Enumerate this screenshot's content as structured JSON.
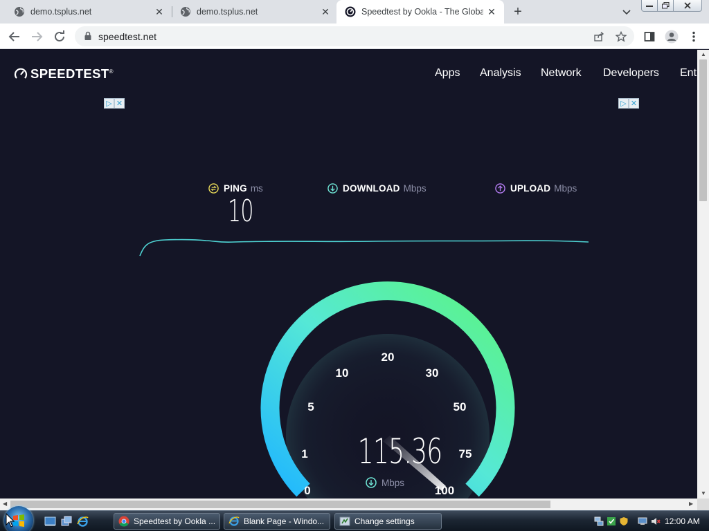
{
  "browser": {
    "tabs": [
      {
        "title": "demo.tsplus.net",
        "active": false
      },
      {
        "title": "demo.tsplus.net",
        "active": false
      },
      {
        "title": "Speedtest by Ookla - The Global",
        "active": true
      }
    ],
    "url": "speedtest.net"
  },
  "site": {
    "logo_text": "SPEEDTEST",
    "nav": [
      "Apps",
      "Analysis",
      "Network",
      "Developers",
      "Ent"
    ]
  },
  "metrics": {
    "ping": {
      "label": "PING",
      "unit": "ms",
      "value": "10"
    },
    "download": {
      "label": "DOWNLOAD",
      "unit": "Mbps"
    },
    "upload": {
      "label": "UPLOAD",
      "unit": "Mbps"
    }
  },
  "gauge": {
    "ticks": [
      "0",
      "1",
      "5",
      "10",
      "20",
      "30",
      "50",
      "75",
      "100"
    ],
    "value": "115.36",
    "unit": "Mbps"
  },
  "colors": {
    "background": "#141526",
    "gauge_start": "#1fb6ff",
    "gauge_end": "#5cf57f",
    "graph_line": "#4fd5d5"
  },
  "taskbar": {
    "items": [
      {
        "label": "Speedtest by Ookla ...",
        "icon": "chrome-icon"
      },
      {
        "label": "Blank Page - Windo...",
        "icon": "ie-icon"
      },
      {
        "label": "Change settings",
        "icon": "settings-icon"
      }
    ],
    "clock": "12:00 AM"
  }
}
